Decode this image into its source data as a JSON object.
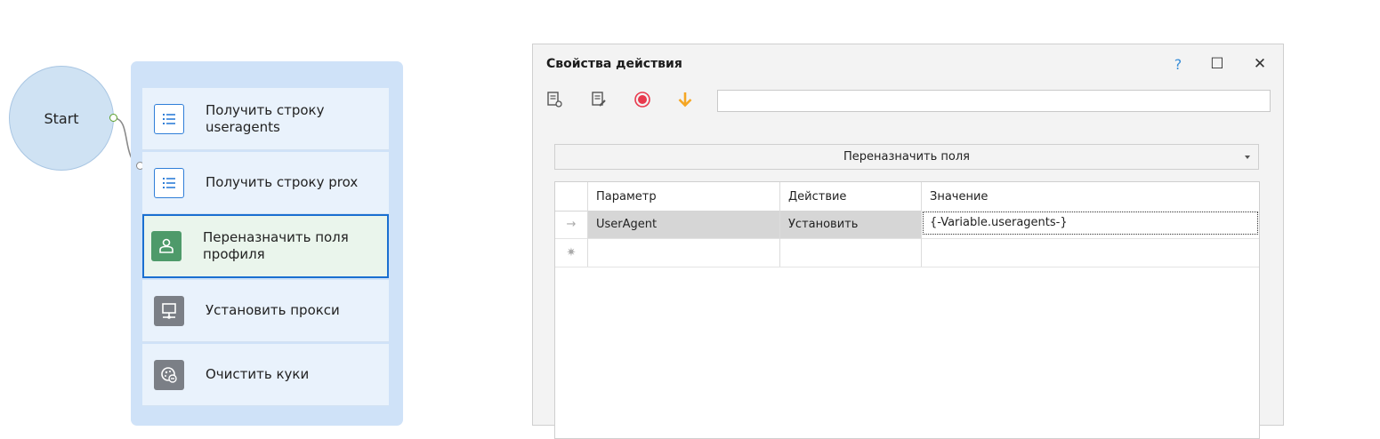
{
  "flow": {
    "start_label": "Start",
    "actions": [
      {
        "label": "Получить строку useragents",
        "icon": "list-icon"
      },
      {
        "label": "Получить строку prox",
        "icon": "list-icon"
      },
      {
        "label": "Переназначить поля профиля",
        "icon": "profile-icon",
        "selected": true
      },
      {
        "label": "Установить прокси",
        "icon": "proxy-icon"
      },
      {
        "label": "Очистить куки",
        "icon": "cookies-icon"
      }
    ]
  },
  "window": {
    "title": "Свойства действия",
    "help": "?",
    "maximize": "☐",
    "close": "✕",
    "toolbar": {
      "buttons": [
        "properties-icon",
        "edit-icon",
        "record-icon",
        "arrow-down-icon"
      ],
      "input_value": ""
    },
    "mode": {
      "selected": "Переназначить поля"
    },
    "table": {
      "columns": [
        "Параметр",
        "Действие",
        "Значение"
      ],
      "rows": [
        {
          "marker": "→",
          "param": "UserAgent",
          "action": "Установить",
          "value": "{-Variable.useragents-}"
        }
      ],
      "new_row_marker": "✷"
    }
  },
  "colors": {
    "start_fill": "#cfe2f3",
    "group_fill": "#cfe2f8",
    "selected_border": "#1a6fd1",
    "record": "#e8394d",
    "arrow": "#f5a623",
    "help": "#3a8fd8"
  }
}
